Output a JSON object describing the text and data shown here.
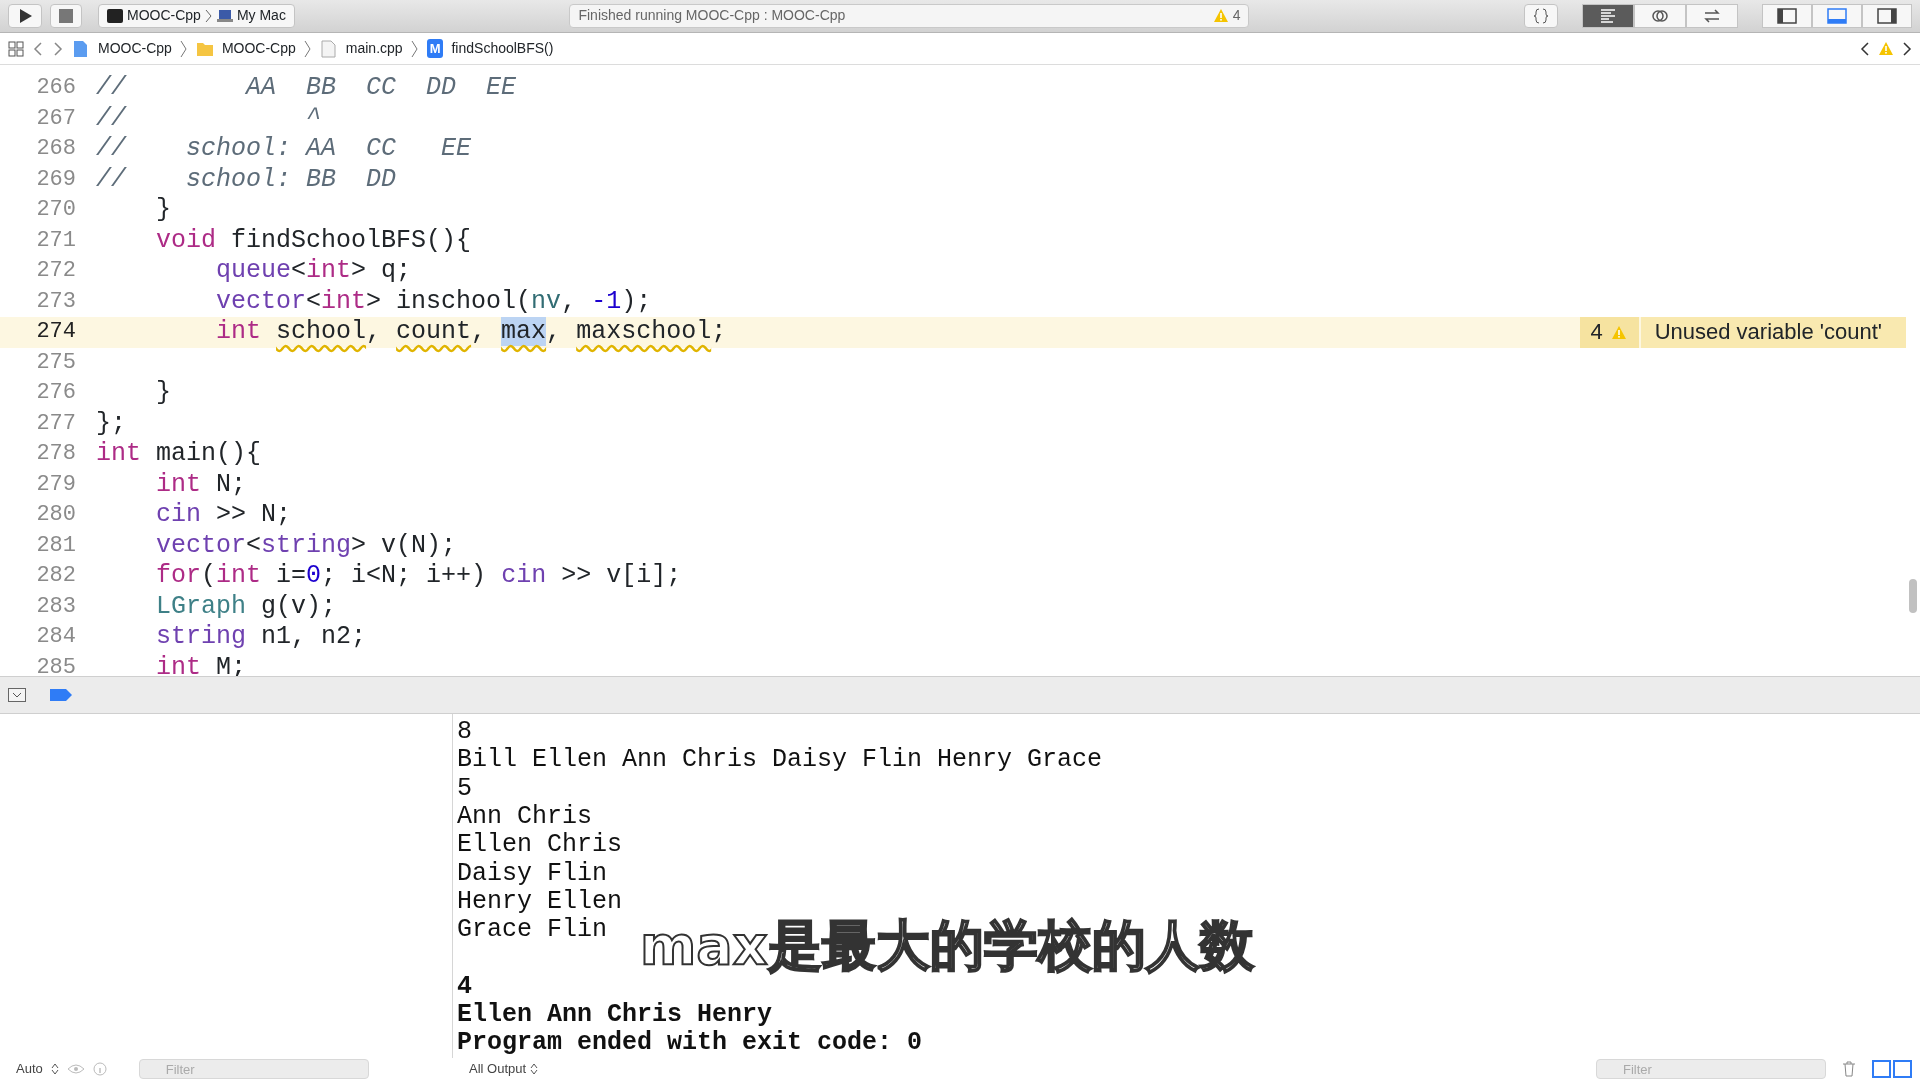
{
  "toolbar": {
    "scheme": "MOOC-Cpp",
    "destination": "My Mac",
    "status": "Finished running MOOC-Cpp : MOOC-Cpp",
    "warning_count": "4",
    "editor_modes": [
      {
        "kind": "standard",
        "selected": true
      },
      {
        "kind": "assistant",
        "selected": false
      },
      {
        "kind": "version",
        "selected": false
      }
    ],
    "panels": [
      {
        "kind": "navigator",
        "on": false
      },
      {
        "kind": "debug",
        "on": true
      },
      {
        "kind": "utilities",
        "on": false
      }
    ]
  },
  "jump_bar": {
    "items": [
      {
        "kind": "project",
        "label": "MOOC-Cpp"
      },
      {
        "kind": "folder",
        "label": "MOOC-Cpp"
      },
      {
        "kind": "file",
        "label": "main.cpp"
      },
      {
        "kind": "method",
        "icon_letter": "M",
        "label": "findSchoolBFS()"
      }
    ]
  },
  "editor": {
    "lines": [
      {
        "number": "266",
        "current": false,
        "tokens": [
          {
            "kind": "comment",
            "text": "//        AA  BB  CC  DD  EE"
          }
        ]
      },
      {
        "number": "267",
        "current": false,
        "tokens": [
          {
            "kind": "comment",
            "text": "//            ^"
          }
        ]
      },
      {
        "number": "268",
        "current": false,
        "tokens": [
          {
            "kind": "comment",
            "text": "//    school: AA  CC   EE"
          }
        ]
      },
      {
        "number": "269",
        "current": false,
        "tokens": [
          {
            "kind": "comment",
            "text": "//    school: BB  DD"
          }
        ]
      },
      {
        "number": "270",
        "current": false,
        "tokens": [
          {
            "kind": "plain",
            "text": "    }"
          }
        ]
      },
      {
        "number": "271",
        "current": false,
        "tokens": [
          {
            "kind": "keyword",
            "text": "    void"
          },
          {
            "kind": "plain",
            "text": " findSchoolBFS(){"
          }
        ]
      },
      {
        "number": "272",
        "current": false,
        "tokens": [
          {
            "kind": "type",
            "text": "        queue"
          },
          {
            "kind": "plain",
            "text": "<"
          },
          {
            "kind": "keyword",
            "text": "int"
          },
          {
            "kind": "plain",
            "text": "> q;"
          }
        ]
      },
      {
        "number": "273",
        "current": false,
        "tokens": [
          {
            "kind": "type",
            "text": "        vector"
          },
          {
            "kind": "plain",
            "text": "<"
          },
          {
            "kind": "keyword",
            "text": "int"
          },
          {
            "kind": "plain",
            "text": "> inschool("
          },
          {
            "kind": "member",
            "text": "nv"
          },
          {
            "kind": "plain",
            "text": ", "
          },
          {
            "kind": "number",
            "text": "-1"
          },
          {
            "kind": "plain",
            "text": ");"
          }
        ]
      },
      {
        "number": "274",
        "current": true,
        "tokens": [
          {
            "kind": "keyword",
            "text": "        int "
          },
          {
            "kind": "warned",
            "text": "school"
          },
          {
            "kind": "plain",
            "text": ", "
          },
          {
            "kind": "warned",
            "text": "count"
          },
          {
            "kind": "plain",
            "text": ", "
          },
          {
            "kind": "selected",
            "text": "max"
          },
          {
            "kind": "plain",
            "text": ", "
          },
          {
            "kind": "warned",
            "text": "maxschool"
          },
          {
            "kind": "plain",
            "text": ";"
          }
        ],
        "issue": {
          "count": "4",
          "message": "Unused variable 'count'"
        }
      },
      {
        "number": "275",
        "current": false
      },
      {
        "number": "276",
        "current": false,
        "tokens": [
          {
            "kind": "plain",
            "text": "    }"
          }
        ]
      },
      {
        "number": "277",
        "current": false,
        "tokens": [
          {
            "kind": "plain",
            "text": "};"
          }
        ]
      },
      {
        "number": "278",
        "current": false,
        "tokens": [
          {
            "kind": "keyword",
            "text": "int"
          },
          {
            "kind": "plain",
            "text": " main(){"
          }
        ]
      },
      {
        "number": "279",
        "current": false,
        "tokens": [
          {
            "kind": "keyword",
            "text": "    int"
          },
          {
            "kind": "plain",
            "text": " N;"
          }
        ]
      },
      {
        "number": "280",
        "current": false,
        "tokens": [
          {
            "kind": "type",
            "text": "    cin"
          },
          {
            "kind": "plain",
            "text": " >> N;"
          }
        ]
      },
      {
        "number": "281",
        "current": false,
        "tokens": [
          {
            "kind": "type",
            "text": "    vector"
          },
          {
            "kind": "plain",
            "text": "<"
          },
          {
            "kind": "type",
            "text": "string"
          },
          {
            "kind": "plain",
            "text": "> v(N);"
          }
        ]
      },
      {
        "number": "282",
        "current": false,
        "tokens": [
          {
            "kind": "keyword",
            "text": "    for"
          },
          {
            "kind": "plain",
            "text": "("
          },
          {
            "kind": "keyword",
            "text": "int"
          },
          {
            "kind": "plain",
            "text": " i="
          },
          {
            "kind": "number",
            "text": "0"
          },
          {
            "kind": "plain",
            "text": "; i<N; i++) "
          },
          {
            "kind": "type",
            "text": "cin"
          },
          {
            "kind": "plain",
            "text": " >> v[i];"
          }
        ]
      },
      {
        "number": "283",
        "current": false,
        "tokens": [
          {
            "kind": "class",
            "text": "    LGraph"
          },
          {
            "kind": "plain",
            "text": " g(v);"
          }
        ]
      },
      {
        "number": "284",
        "current": false,
        "tokens": [
          {
            "kind": "type",
            "text": "    string"
          },
          {
            "kind": "plain",
            "text": " n1, n2;"
          }
        ]
      },
      {
        "number": "285",
        "current": false,
        "tokens": [
          {
            "kind": "keyword",
            "text": "    int"
          },
          {
            "kind": "plain",
            "text": " M;"
          }
        ]
      }
    ]
  },
  "console": {
    "lines": [
      {
        "kind": "input",
        "text": "8"
      },
      {
        "kind": "input",
        "text": "Bill Ellen Ann Chris Daisy Flin Henry Grace"
      },
      {
        "kind": "input",
        "text": "5"
      },
      {
        "kind": "input",
        "text": "Ann Chris"
      },
      {
        "kind": "input",
        "text": "Ellen Chris"
      },
      {
        "kind": "input",
        "text": "Daisy Flin"
      },
      {
        "kind": "input",
        "text": "Henry Ellen"
      },
      {
        "kind": "input",
        "text": "Grace Flin"
      },
      {
        "kind": "output",
        "text": "4"
      },
      {
        "kind": "output",
        "text": "Ellen Ann Chris Henry"
      },
      {
        "kind": "output",
        "text": "Program ended with exit code: 0"
      }
    ],
    "subtitle": "max是最大的学校的人数"
  },
  "bottom_bar": {
    "scope": "Auto",
    "left_filter": {
      "placeholder": "Filter"
    },
    "output": "All Output",
    "right_filter": {
      "placeholder": "Filter"
    }
  }
}
